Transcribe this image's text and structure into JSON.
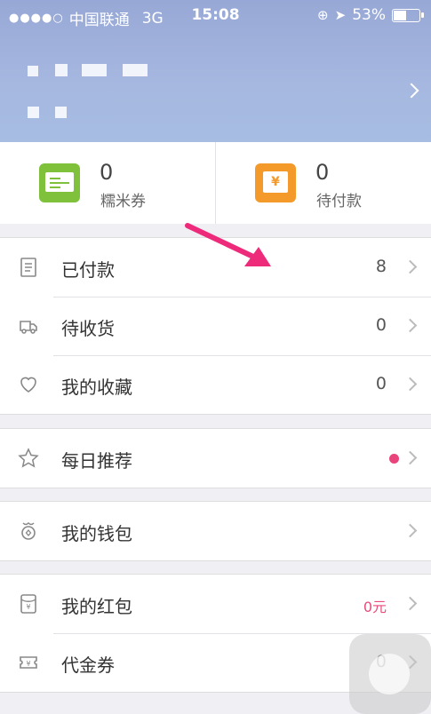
{
  "status_bar": {
    "carrier": "中国联通",
    "network": "3G",
    "time": "15:08",
    "battery": "53%",
    "battery_level": 0.53
  },
  "stats": [
    {
      "value": "0",
      "label": "糯米券",
      "icon": "coupon-icon"
    },
    {
      "value": "0",
      "label": "待付款",
      "icon": "payment-pending-icon"
    }
  ],
  "orders": [
    {
      "label": "已付款",
      "value": "8",
      "icon": "receipt-icon"
    },
    {
      "label": "待收货",
      "value": "0",
      "icon": "delivery-icon"
    },
    {
      "label": "我的收藏",
      "value": "0",
      "icon": "heart-icon"
    }
  ],
  "recommend": {
    "label": "每日推荐",
    "icon": "star-icon",
    "badge_color": "#e9447b"
  },
  "wallet": {
    "label": "我的钱包",
    "icon": "wallet-icon"
  },
  "finance": [
    {
      "label": "我的红包",
      "value": "0元",
      "icon": "red-packet-icon"
    },
    {
      "label": "代金券",
      "value": "0",
      "icon": "voucher-icon"
    }
  ],
  "colors": {
    "accent": "#e9447b",
    "header": "#a6b8e0",
    "coupon": "#7fc13a",
    "pay": "#f39a2b"
  }
}
